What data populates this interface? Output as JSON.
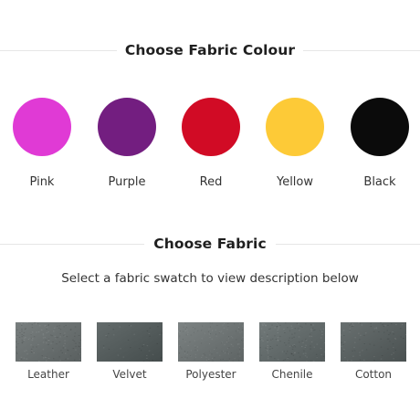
{
  "colour_section": {
    "title": "Choose Fabric Colour",
    "options": [
      {
        "label": "Pink",
        "color": "#e03ad5"
      },
      {
        "label": "Purple",
        "color": "#731e80"
      },
      {
        "label": "Red",
        "color": "#d10b25"
      },
      {
        "label": "Yellow",
        "color": "#fdca37"
      },
      {
        "label": "Black",
        "color": "#0b0b0b"
      }
    ]
  },
  "fabric_section": {
    "title": "Choose Fabric",
    "instruction": "Select a fabric swatch to view description below",
    "options": [
      {
        "label": "Leather",
        "color": "#666d6d"
      },
      {
        "label": "Velvet",
        "color": "#4e5757"
      },
      {
        "label": "Polyester",
        "color": "#6b7272"
      },
      {
        "label": "Chenile",
        "color": "#5e6767"
      },
      {
        "label": "Cotton",
        "color": "#545c5c"
      }
    ]
  }
}
